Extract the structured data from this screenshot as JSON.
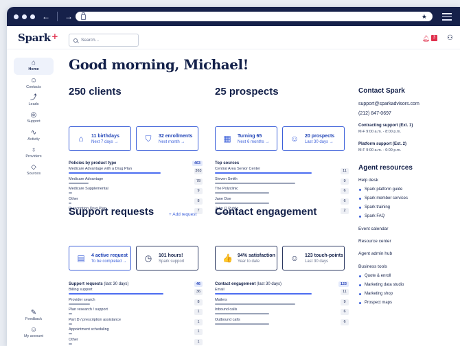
{
  "browser": {
    "back_glyph": "←",
    "forward_glyph": "→",
    "icons": [
      "back-icon",
      "forward-icon",
      "lock-icon",
      "star-icon",
      "menu-icon"
    ]
  },
  "app": {
    "logo": "Spark",
    "logo_mark": "+"
  },
  "search": {
    "placeholder": "Search..."
  },
  "notifications": {
    "count": "3"
  },
  "sidebar": {
    "items": [
      {
        "label": "Home",
        "icon": "home-icon",
        "glyph": "⌂"
      },
      {
        "label": "Contacts",
        "icon": "contacts-icon",
        "glyph": "☺"
      },
      {
        "label": "Leads",
        "icon": "leads-icon",
        "glyph": "⤴"
      },
      {
        "label": "Support",
        "icon": "support-icon",
        "glyph": "◎"
      },
      {
        "label": "Activity",
        "icon": "activity-icon",
        "glyph": "∿"
      },
      {
        "label": "Providers",
        "icon": "providers-icon",
        "glyph": "♁"
      },
      {
        "label": "Sources",
        "icon": "sources-icon",
        "glyph": "◇"
      }
    ],
    "bottom": [
      {
        "label": "Feedback",
        "icon": "feedback-icon",
        "glyph": "✎"
      },
      {
        "label": "My account",
        "icon": "account-icon",
        "glyph": "☺"
      }
    ]
  },
  "greeting": "Good morning, Michael!",
  "clients": {
    "title": "250 clients",
    "cards": [
      {
        "title": "11 birthdays",
        "sub": "Next 7 days →",
        "icon": "cake-icon",
        "glyph": "⌂"
      },
      {
        "title": "32 enrollments",
        "sub": "Next month →",
        "icon": "shield-icon",
        "glyph": "⛉"
      }
    ],
    "table": {
      "title": "Policies by product type",
      "total": "463",
      "rows": [
        {
          "label": "Medicare Advantage with a Drug Plan",
          "count": "363",
          "fill": 0.78
        },
        {
          "label": "Medicare Advantage",
          "count": "78",
          "fill": 0.17
        },
        {
          "label": "Medicare Supplemental",
          "count": "9",
          "fill": 0.03
        },
        {
          "label": "Other",
          "count": "8",
          "fill": 0.02
        },
        {
          "label": "Prescription Drug Plan",
          "count": "7",
          "fill": 0.02
        }
      ]
    }
  },
  "prospects": {
    "title": "25 prospects",
    "cards": [
      {
        "title": "Turning 65",
        "sub": "Next 6 months →",
        "icon": "calendar-icon",
        "glyph": "▦"
      },
      {
        "title": "20 prospects",
        "sub": "Last 30 days →",
        "icon": "people-icon",
        "glyph": "☺"
      }
    ],
    "table": {
      "title": "Top sources",
      "total": "",
      "rows": [
        {
          "label": "Central Area Senior Center",
          "count": "11",
          "fill": 0.82
        },
        {
          "label": "Steven Smith",
          "count": "9",
          "fill": 0.68
        },
        {
          "label": "The Polyclinic",
          "count": "6",
          "fill": 0.46
        },
        {
          "label": "Jane Doe",
          "count": "6",
          "fill": 0.46
        },
        {
          "label": "John Q Public",
          "count": "2",
          "fill": 0.16
        }
      ]
    }
  },
  "support": {
    "title": "Support requests",
    "add_label": "+ Add request",
    "cards": [
      {
        "title": "4 active request",
        "sub": "To be completed →",
        "icon": "clipboard-icon",
        "glyph": "▤"
      },
      {
        "title": "101 hours!",
        "sub": "Spark support",
        "icon": "clock-icon",
        "glyph": "◷"
      }
    ],
    "table": {
      "title": "Support requests",
      "title_suffix": " (last 30 days)",
      "total": "46",
      "rows": [
        {
          "label": "Billing support",
          "count": "36",
          "fill": 0.8
        },
        {
          "label": "Provider search",
          "count": "8",
          "fill": 0.18
        },
        {
          "label": "Plan research / support",
          "count": "1",
          "fill": 0.03
        },
        {
          "label": "Part D / prescription assistance",
          "count": "1",
          "fill": 0.03
        },
        {
          "label": "Appointment scheduling",
          "count": "1",
          "fill": 0.03
        },
        {
          "label": "Other",
          "count": "1",
          "fill": 0.03
        }
      ]
    }
  },
  "engagement": {
    "title": "Contact engagement",
    "cards": [
      {
        "title": "94% satisfaction",
        "sub": "Year to date",
        "icon": "thumbs-up-icon",
        "glyph": "👍"
      },
      {
        "title": "123 touch-points",
        "sub": "Last 30 days",
        "icon": "touch-icon",
        "glyph": "☺"
      }
    ],
    "table": {
      "title": "Contact engagement",
      "title_suffix": " (last 30 days)",
      "total": "123",
      "rows": [
        {
          "label": "Email",
          "count": "11",
          "fill": 0.82
        },
        {
          "label": "Mailers",
          "count": "9",
          "fill": 0.68
        },
        {
          "label": "Inbound calls",
          "count": "6",
          "fill": 0.46
        },
        {
          "label": "Outbound calls",
          "count": "6",
          "fill": 0.46
        }
      ]
    }
  },
  "contact": {
    "title": "Contact Spark",
    "email": "support@sparkadvisors.com",
    "phone": "(212) 847-0697",
    "contracting_label": "Contracting support (Ext. 1)",
    "contracting_hours": "M-F 9:00 a.m. - 8:00 p.m.",
    "platform_label": "Platform support (Ext. 2)",
    "platform_hours": "M-F 9:00 a.m. - 6:00 p.m."
  },
  "resources": {
    "title": "Agent resources",
    "help_desk": "Help desk",
    "help_items": [
      "Spark platform guide",
      "Spark member services",
      "Spark training",
      "Spark FAQ"
    ],
    "links": [
      "Event calendar",
      "Resource center",
      "Agent admin hub"
    ],
    "business_tools": "Business tools",
    "tool_items": [
      "Quote & enroll",
      "Marketing data studio",
      "Marketing shop",
      "Prospect maps"
    ]
  },
  "colors": {
    "brand": "#14214a",
    "accent": "#3b5fd9",
    "alert": "#e0304d"
  }
}
